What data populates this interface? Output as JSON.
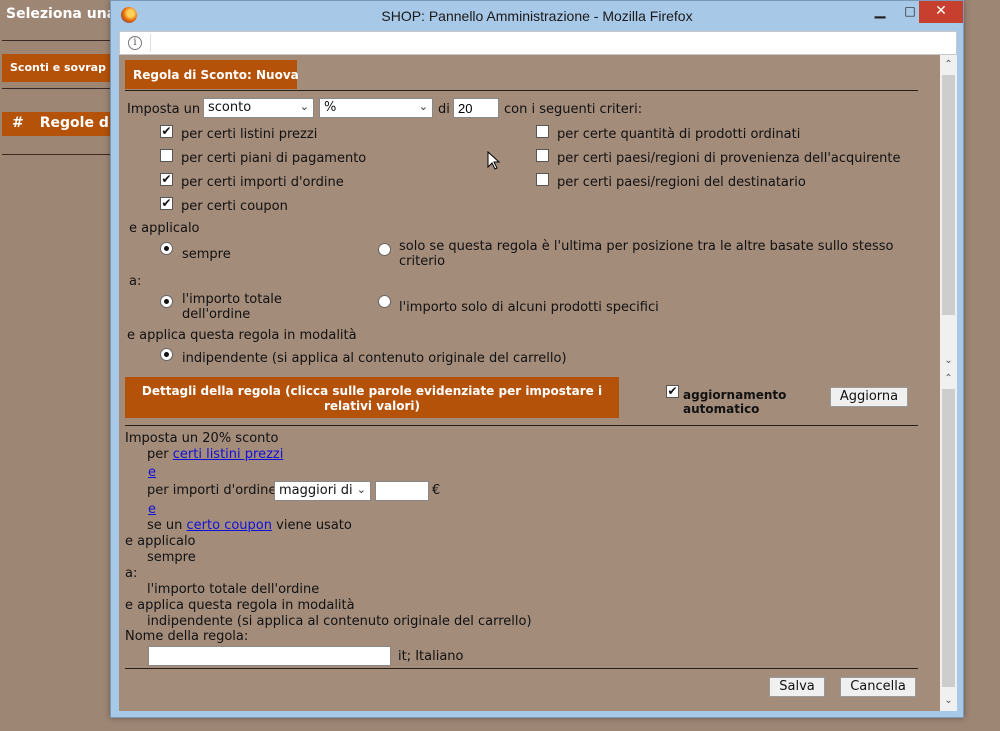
{
  "background": {
    "title": "Seleziona una",
    "button": "Sconti e sovrap",
    "table_header": {
      "hash": "#",
      "col": "Regole di"
    }
  },
  "window": {
    "title": "SHOP: Pannello Amministrazione - Mozilla Firefox",
    "min": "▁",
    "max": "□",
    "close": "✕"
  },
  "panel_title": "Regola di Sconto: Nuova",
  "criteria": {
    "prefix": "Imposta un",
    "type_value": "sconto",
    "unit_value": "%",
    "di": "di",
    "amount": "20",
    "suffix": "con i seguenti criteri:",
    "items": [
      {
        "label": "per certi listini prezzi",
        "checked": true,
        "mark": "✔"
      },
      {
        "label": "per certi piani di pagamento",
        "checked": false,
        "mark": ""
      },
      {
        "label": "per certi importi d'ordine",
        "checked": true,
        "mark": "✔"
      },
      {
        "label": "per certi coupon",
        "checked": true,
        "mark": "✔"
      },
      {
        "label": "per certe quantità di prodotti ordinati",
        "checked": false,
        "mark": ""
      },
      {
        "label": "per certi paesi/regioni di provenienza dell'acquirente",
        "checked": false,
        "mark": ""
      },
      {
        "label": "per certi paesi/regioni del destinatario",
        "checked": false,
        "mark": ""
      }
    ]
  },
  "apply": {
    "label": "e applicalo",
    "always": "sempre",
    "last_only": "solo se questa regola è l'ultima per posizione tra le altre basate sullo stesso criterio",
    "to_label": "a:",
    "order_total": "l'importo totale dell'ordine",
    "specific_products": "l'importo solo di alcuni prodotti specifici",
    "mode_label": "e applica questa regola in modalità",
    "independent": "indipendente (si applica al contenuto originale del carrello)"
  },
  "details": {
    "header": "Dettagli della regola (clicca sulle parole evidenziate per impostare i relativi valori)",
    "auto_update": "aggiornamento automatico",
    "auto_mark": "✔",
    "update_button": "Aggiorna"
  },
  "summary": {
    "line1": "Imposta un 20% sconto",
    "per": "per",
    "link_listini": "certi listini prezzi",
    "and1": "e",
    "per_importi": "per importi d'ordine",
    "comparator": "maggiori di",
    "amount_value": "",
    "currency": "€",
    "and2": "e",
    "se_un": "se un",
    "link_coupon": "certo coupon",
    "viene_usato": "viene usato",
    "applicalo": "e applicalo",
    "sempre": "sempre",
    "a": "a:",
    "importo_totale": "l'importo totale dell'ordine",
    "modalita": "e applica questa regola in modalità",
    "indipendente": "indipendente (si applica al contenuto originale del carrello)",
    "name_label": "Nome della regola:",
    "name_value": "",
    "lang": "it; Italiano"
  },
  "footer": {
    "save": "Salva",
    "cancel": "Cancella"
  },
  "scroll": {
    "up": "⌃",
    "down": "⌄"
  }
}
